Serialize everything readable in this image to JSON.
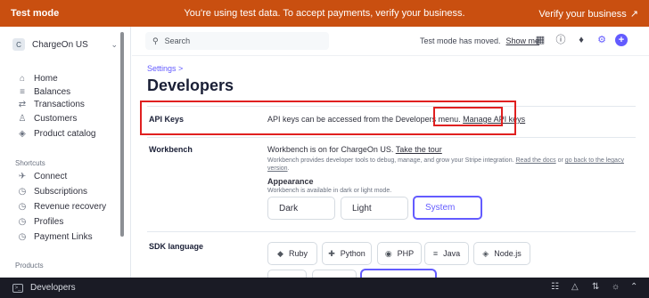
{
  "banner": {
    "mode": "Test mode",
    "message": "You're using test data. To accept payments, verify your business.",
    "verify": "Verify your business",
    "verify_arrow": "↗"
  },
  "sidebar": {
    "account_badge": "C",
    "account_name": "ChargeOn US",
    "items": [
      {
        "label": "Home",
        "icon": "home-icon",
        "glyph": "⌂"
      },
      {
        "label": "Balances",
        "icon": "balances-icon",
        "glyph": "≡"
      },
      {
        "label": "Transactions",
        "icon": "transactions-icon",
        "glyph": "⇄"
      },
      {
        "label": "Customers",
        "icon": "customers-icon",
        "glyph": "♙"
      },
      {
        "label": "Product catalog",
        "icon": "product-catalog-icon",
        "glyph": "◈"
      }
    ],
    "shortcuts_heading": "Shortcuts",
    "shortcuts": [
      {
        "label": "Connect",
        "icon": "connect-icon",
        "glyph": "✈"
      },
      {
        "label": "Subscriptions",
        "icon": "clock-icon",
        "glyph": "◷"
      },
      {
        "label": "Revenue recovery",
        "icon": "clock-icon",
        "glyph": "◷"
      },
      {
        "label": "Profiles",
        "icon": "clock-icon",
        "glyph": "◷"
      },
      {
        "label": "Payment Links",
        "icon": "clock-icon",
        "glyph": "◷"
      }
    ],
    "products_heading": "Products"
  },
  "header": {
    "search_placeholder": "Search",
    "test_mode_moved": "Test mode has moved.",
    "show_me": "Show me"
  },
  "main": {
    "breadcrumb": "Settings",
    "breadcrumb_sep": ">",
    "title": "Developers",
    "api_keys": {
      "label": "API Keys",
      "text": "API keys can be accessed from the Developers menu.",
      "link": "Manage API keys"
    },
    "workbench": {
      "label": "Workbench",
      "text": "Workbench is on for ChargeOn US.",
      "link": "Take the tour",
      "desc_1": "Workbench provides developer tools to debug, manage, and grow your Stripe integration.",
      "docs_link": "Read the docs",
      "or": "or",
      "legacy_link": "go back to the legacy",
      "legacy_link_2": "version",
      "appearance_title": "Appearance",
      "appearance_desc": "Workbench is available in dark or light mode.",
      "options": [
        "Dark",
        "Light",
        "System"
      ],
      "selected": "System"
    },
    "sdk": {
      "label": "SDK language",
      "languages": [
        "Ruby",
        "Python",
        "PHP",
        "Java",
        "Node.js"
      ]
    }
  },
  "bottom": {
    "label": "Developers"
  },
  "colors": {
    "banner": "#c94f10",
    "accent": "#635bff",
    "highlight": "#e02020",
    "bottom_bar": "#1a1b25"
  }
}
